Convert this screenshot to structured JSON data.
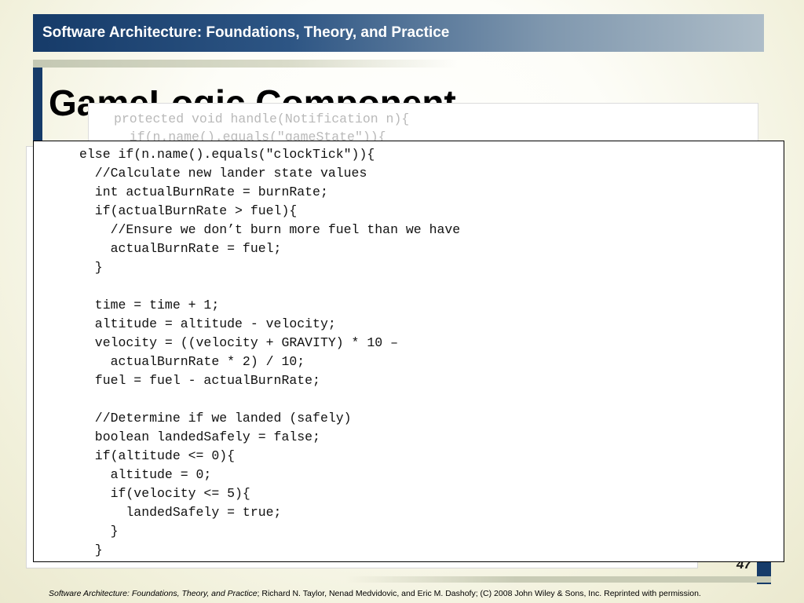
{
  "header": {
    "title": "Software Architecture: Foundations, Theory, and Practice"
  },
  "slide": {
    "title": "GameLogic Component",
    "page_number": "47"
  },
  "back_code": [
    "protected void handle(Notification n){",
    "  if(n.name().equals(\"gameState\")){"
  ],
  "front_code": [
    "else if(n.name().equals(\"clockTick\")){",
    "  //Calculate new lander state values",
    "  int actualBurnRate = burnRate;",
    "  if(actualBurnRate > fuel){",
    "    //Ensure we don’t burn more fuel than we have",
    "    actualBurnRate = fuel;",
    "  }",
    "",
    "  time = time + 1;",
    "  altitude = altitude - velocity;",
    "  velocity = ((velocity + GRAVITY) * 10 –",
    "    actualBurnRate * 2) / 10;",
    "  fuel = fuel - actualBurnRate;",
    "",
    "  //Determine if we landed (safely)",
    "  boolean landedSafely = false;",
    "  if(altitude <= 0){",
    "    altitude = 0;",
    "    if(velocity <= 5){",
    "      landedSafely = true;",
    "    }",
    "  }"
  ],
  "footer": {
    "book_title": "Software Architecture: Foundations, Theory, and Practice",
    "credits": "; Richard N. Taylor, Nenad Medvidovic, and Eric M. Dashofy; (C) 2008 John Wiley & Sons, Inc. Reprinted with permission."
  },
  "colors": {
    "header_dark": "#163b69",
    "header_light": "#aebdc8",
    "background": "#f1f0da"
  }
}
